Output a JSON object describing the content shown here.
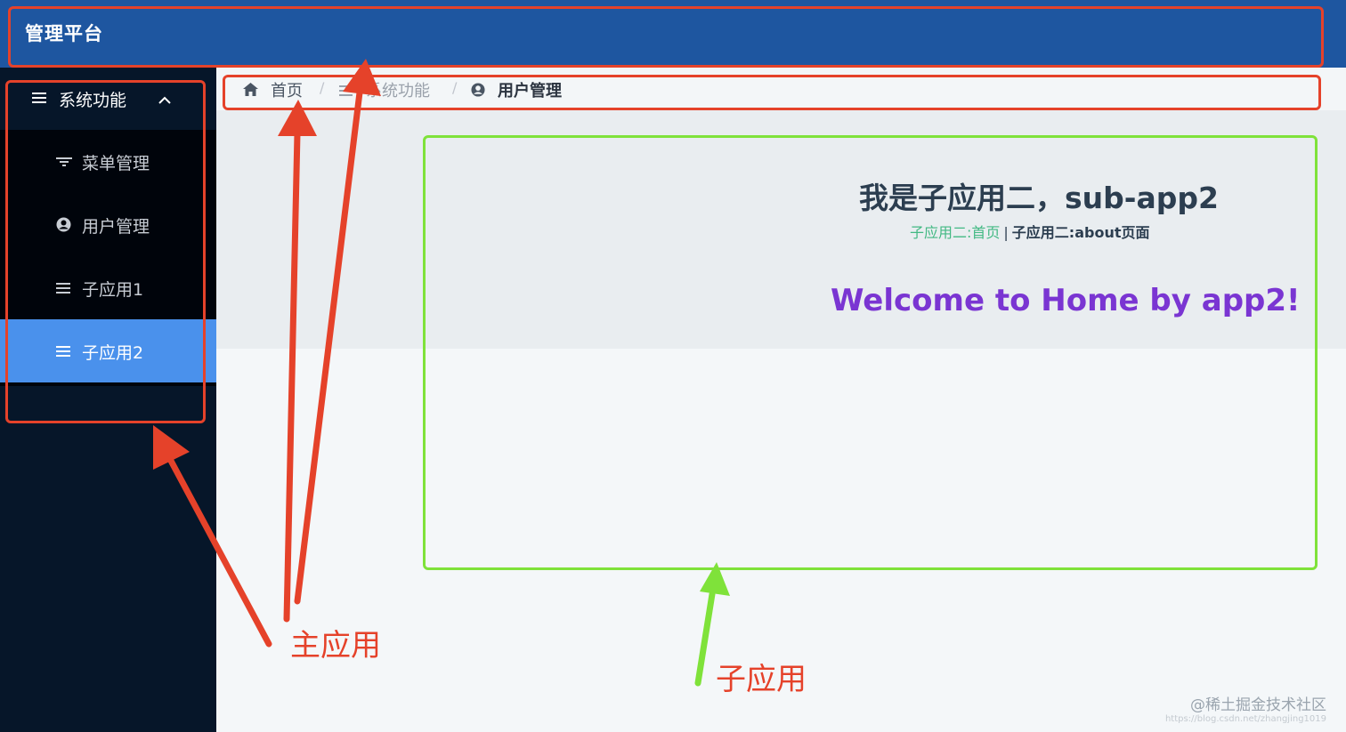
{
  "header": {
    "title": "管理平台"
  },
  "sidebar": {
    "group": {
      "label": "系统功能",
      "icon": "menu-lines-icon",
      "chevron": "chevron-up-icon"
    },
    "items": [
      {
        "label": "菜单管理",
        "icon": "filter-icon"
      },
      {
        "label": "用户管理",
        "icon": "user-circle-icon"
      },
      {
        "label": "子应用1",
        "icon": "menu-lines-icon"
      },
      {
        "label": "子应用2",
        "icon": "menu-lines-icon",
        "active": true
      }
    ]
  },
  "breadcrumb": {
    "home": "首页",
    "section": "系统功能",
    "current": "用户管理",
    "separator": "/"
  },
  "sub_app": {
    "title": "我是子应用二，sub-app2",
    "nav_home": "子应用二:首页",
    "nav_sep": "|",
    "nav_about": "子应用二:about页面",
    "welcome": "Welcome to Home by app2!"
  },
  "annotations": {
    "main_app_label": "主应用",
    "sub_app_label": "子应用",
    "red": "#e5422a",
    "green": "#7fe23a"
  },
  "watermark": {
    "text": "@稀土掘金技术社区",
    "url": "https://blog.csdn.net/zhangjing1019"
  },
  "colors": {
    "header": "#1e56a0",
    "sidebar": "#061629",
    "active_item": "#4a91ec",
    "welcome": "#7a35d2",
    "link_home": "#42b983"
  }
}
